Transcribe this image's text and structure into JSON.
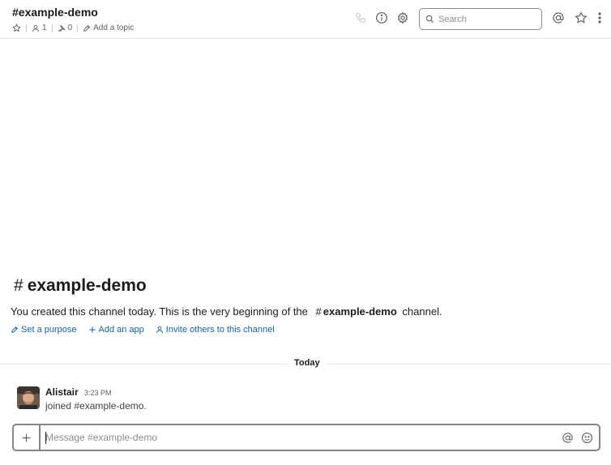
{
  "header": {
    "channel_name": "#example-demo",
    "member_count": "1",
    "pinned_count": "0",
    "add_topic_label": "Add a topic",
    "search_placeholder": "Search",
    "icons": [
      "star-icon",
      "member-icon",
      "pin-icon",
      "pencil-icon",
      "phone-icon",
      "info-icon",
      "gear-icon",
      "search-icon",
      "at-icon",
      "star-icon",
      "more-vertical-icon"
    ]
  },
  "intro": {
    "hash": "#",
    "channel_name": "example-demo",
    "text_before": "You created this channel today. This is the very beginning of the",
    "channel_ref_hash": "#",
    "channel_ref_name": "example-demo",
    "text_after": "channel.",
    "actions": [
      {
        "icon": "pencil-icon",
        "label": "Set a purpose"
      },
      {
        "icon": "plus-icon",
        "label": "Add an app"
      },
      {
        "icon": "person-icon",
        "label": "Invite others to this channel"
      }
    ]
  },
  "divider": {
    "label": "Today"
  },
  "messages": [
    {
      "author": "Alistair",
      "time": "3:23 PM",
      "text": "joined #example-demo."
    }
  ],
  "composer": {
    "placeholder": "Message #example-demo",
    "value": ""
  },
  "colors": {
    "link": "#1264a3",
    "text": "#1d1c1d",
    "muted": "#616061",
    "border": "#868686",
    "divider": "#e3e3e3"
  }
}
